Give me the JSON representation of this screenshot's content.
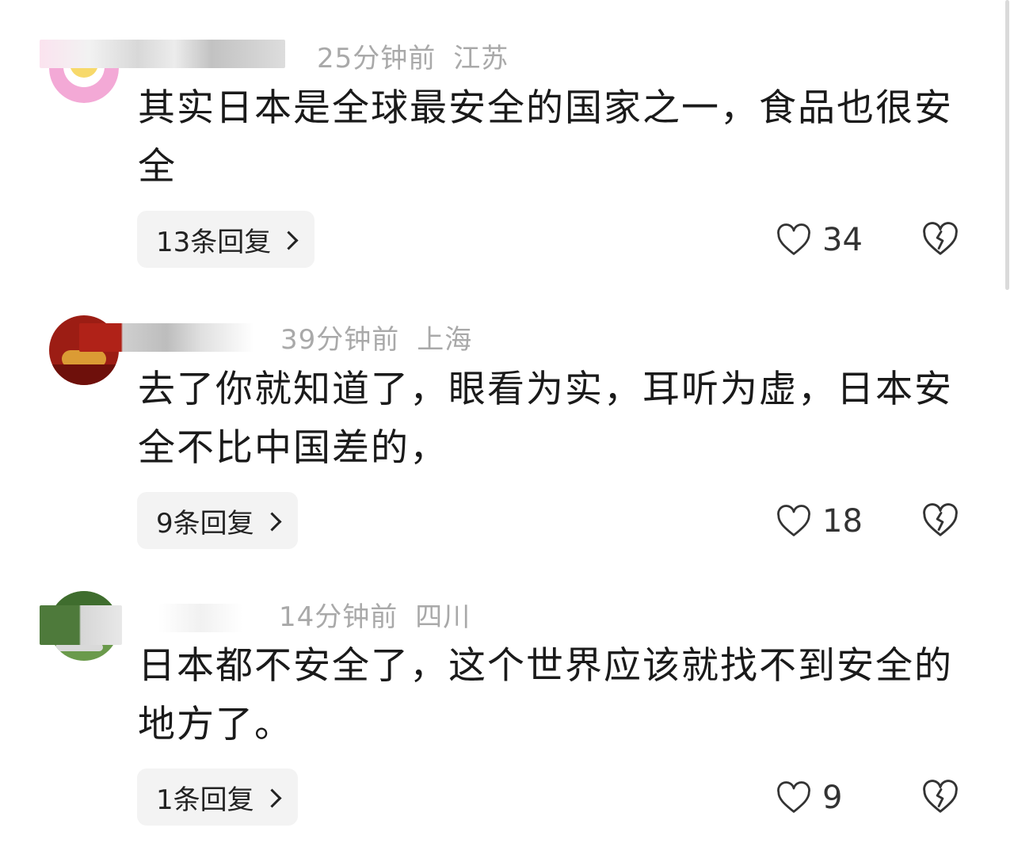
{
  "comments": [
    {
      "time": "25分钟前",
      "location": "江苏",
      "text": "其实日本是全球最安全的国家之一，食品也很安全",
      "replies_label": "13条回复",
      "likes": "34",
      "avatar_color": "#f3a9d6"
    },
    {
      "time": "39分钟前",
      "location": "上海",
      "text": "去了你就知道了，眼看为实，耳听为虚，日本安全不比中国差的，",
      "replies_label": "9条回复",
      "likes": "18",
      "avatar_color": "#9c1d14"
    },
    {
      "time": "14分钟前",
      "location": "四川",
      "text": "日本都不安全了，这个世界应该就找不到安全的地方了。",
      "replies_label": "1条回复",
      "likes": "9",
      "avatar_color": "#4e7a3b"
    }
  ],
  "icons": {
    "like": "heart-outline-icon",
    "dislike": "broken-heart-icon",
    "reply_arrow": "chevron-right-icon"
  },
  "colors": {
    "meta_text": "#a9a9a9",
    "body_text": "#1a1a1a",
    "reply_bg": "#f3f3f3"
  }
}
